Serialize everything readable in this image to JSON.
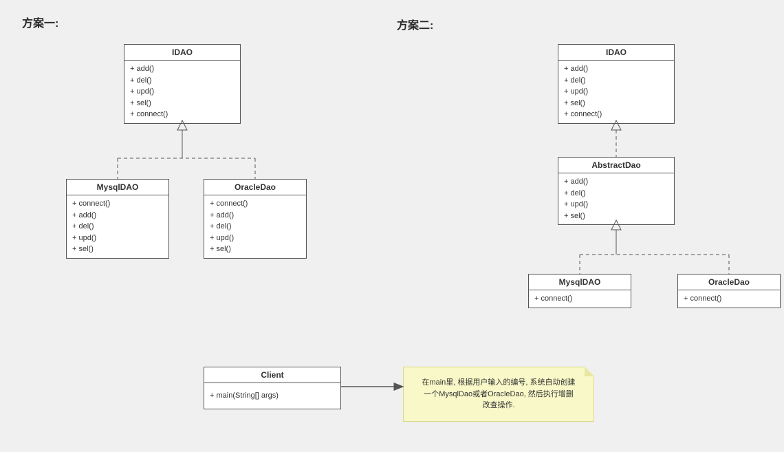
{
  "headings": {
    "plan1": "方案一:",
    "plan2": "方案二:"
  },
  "plan1": {
    "idao": {
      "title": "IDAO",
      "methods": [
        "+ add()",
        "+ del()",
        "+ upd()",
        "+ sel()",
        "+ connect()"
      ]
    },
    "mysql": {
      "title": "MysqlDAO",
      "methods": [
        "+ connect()",
        "+ add()",
        "+ del()",
        "+ upd()",
        "+ sel()"
      ]
    },
    "oracle": {
      "title": "OracleDao",
      "methods": [
        "+ connect()",
        "+ add()",
        "+ del()",
        "+ upd()",
        "+ sel()"
      ]
    }
  },
  "plan2": {
    "idao": {
      "title": "IDAO",
      "methods": [
        "+ add()",
        "+ del()",
        "+ upd()",
        "+ sel()",
        "+ connect()"
      ]
    },
    "abstract": {
      "title": "AbstractDao",
      "methods": [
        "+ add()",
        "+ del()",
        "+ upd()",
        "+ sel()"
      ]
    },
    "mysql": {
      "title": "MysqlDAO",
      "methods": [
        "+ connect()"
      ]
    },
    "oracle": {
      "title": "OracleDao",
      "methods": [
        "+ connect()"
      ]
    }
  },
  "client": {
    "title": "Client",
    "methods": [
      "+ main(String[] args)"
    ]
  },
  "note": {
    "line1": "在main里, 根据用户输入的编号, 系统自动创建",
    "line2": "一个MysqlDao或者OracleDao, 然后执行增删",
    "line3": "改查操作."
  }
}
